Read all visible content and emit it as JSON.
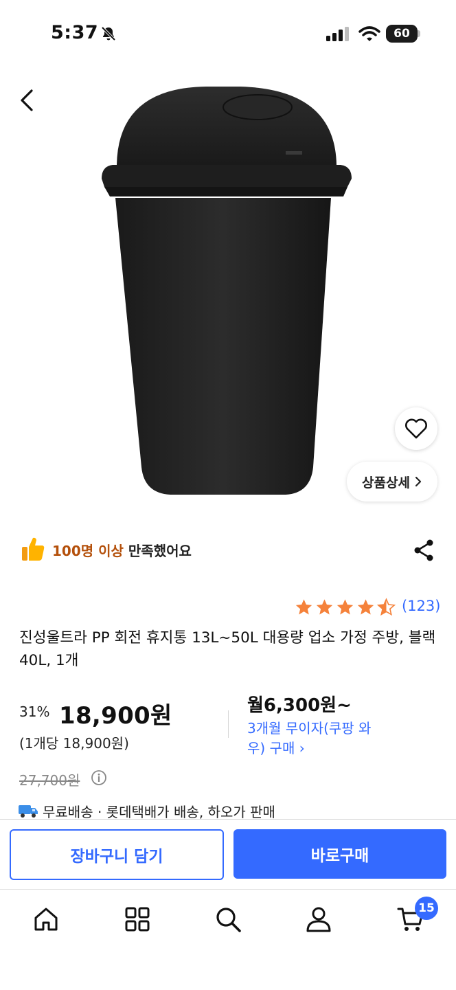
{
  "status_bar": {
    "time": "5:37",
    "battery": "60"
  },
  "product": {
    "detail_button_label": "상품상세",
    "satisfaction": {
      "highlight": "100명 이상",
      "rest": "만족했어요"
    },
    "rating": {
      "stars": 4.5,
      "count": "(123)"
    },
    "title": "진성울트라 PP 회전 휴지통 13L~50L 대용량 업소 가정 주방, 블랙 40L, 1개"
  },
  "price": {
    "discount": "31%",
    "sale_price": "18,900원",
    "unit_price": "(1개당 18,900원)",
    "original_price": "27,700원",
    "monthly": "월6,300원~",
    "installment": "3개월 무이자(쿠팡 와우) 구매 ›"
  },
  "delivery": {
    "text": "무료배송 · 롯데택배가 배송, 하오가 판매"
  },
  "actions": {
    "cart_label": "장바구니 담기",
    "buy_label": "바로구매"
  },
  "nav": {
    "cart_badge": "15"
  },
  "colors": {
    "accent": "#346aff",
    "highlight": "#b4500b",
    "star": "#f5823b"
  }
}
